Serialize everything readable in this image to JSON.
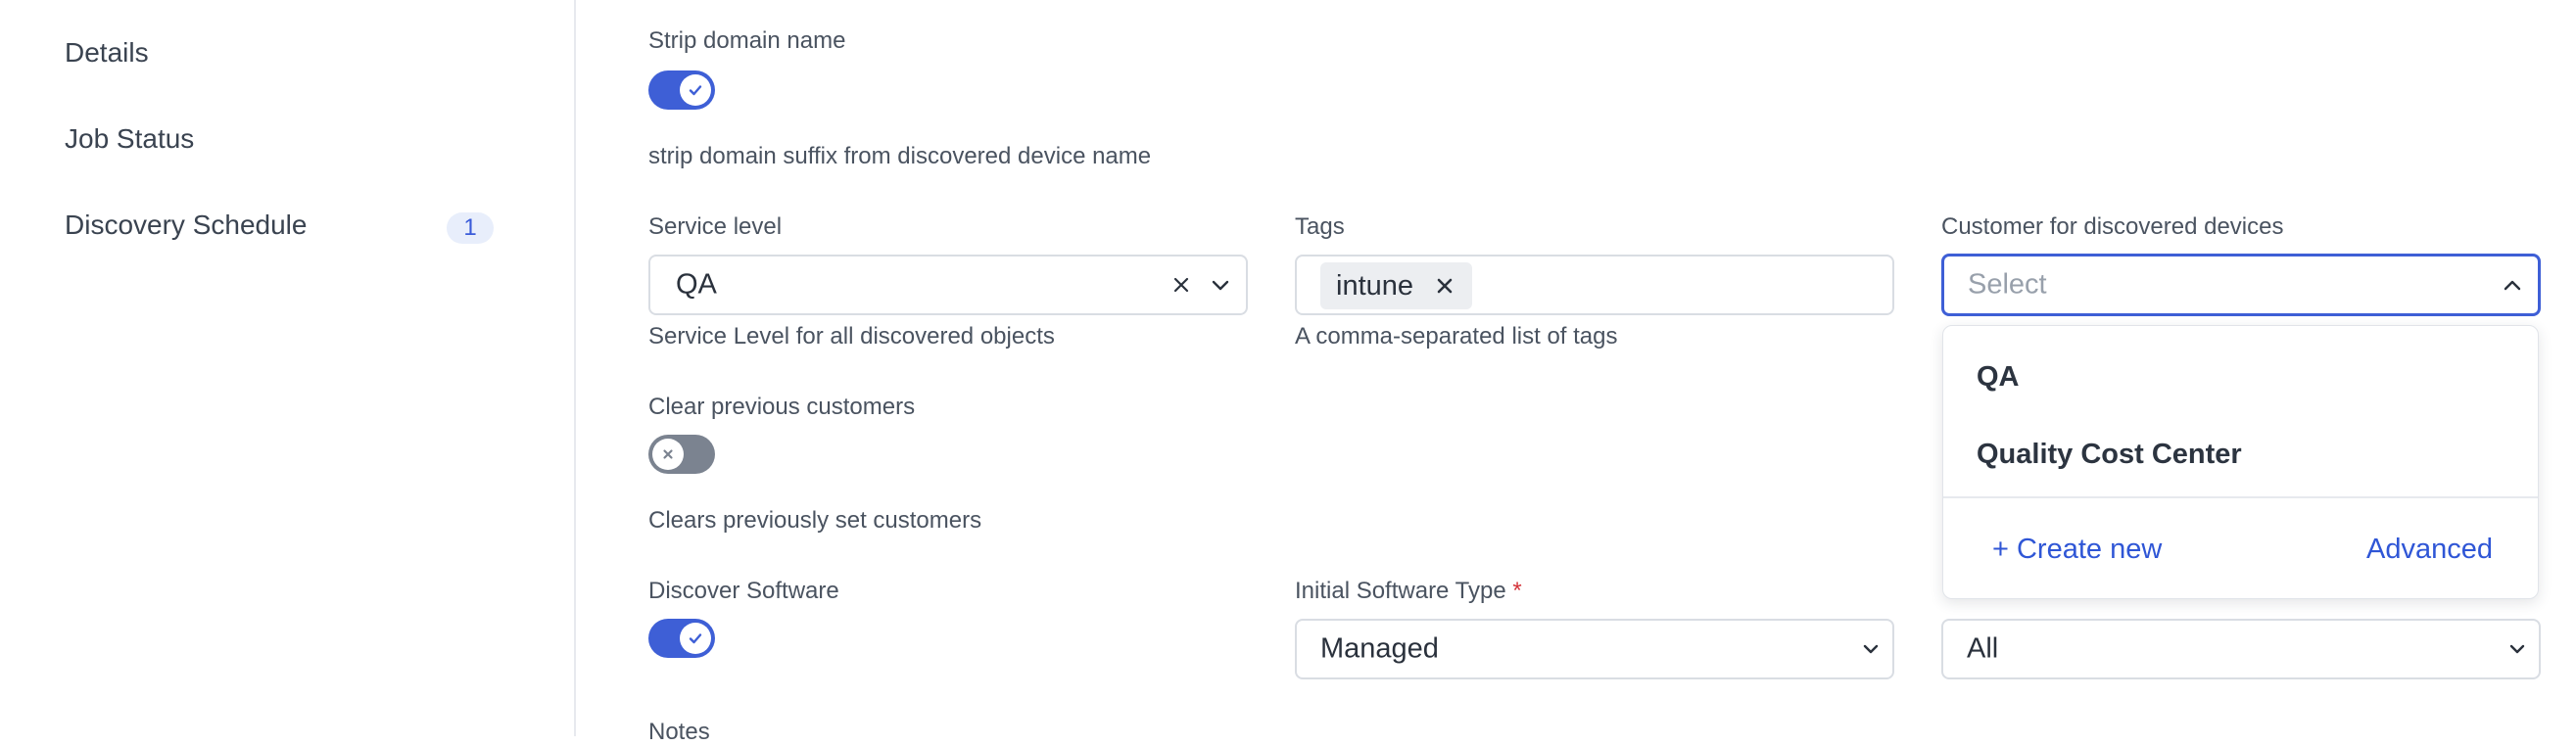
{
  "sidebar": {
    "items": [
      {
        "label": "Details"
      },
      {
        "label": "Job Status"
      },
      {
        "label": "Discovery Schedule",
        "badge": "1"
      }
    ]
  },
  "form": {
    "strip_domain": {
      "label": "Strip domain name",
      "enabled": true,
      "help": "strip domain suffix from discovered device name"
    },
    "service_level": {
      "label": "Service level",
      "value": "QA",
      "help": "Service Level for all discovered objects"
    },
    "tags": {
      "label": "Tags",
      "chips": [
        "intune"
      ],
      "help": "A comma-separated list of tags"
    },
    "customer": {
      "label": "Customer for discovered devices",
      "placeholder": "Select",
      "options": [
        "QA",
        "Quality Cost Center"
      ],
      "create_new": "+ Create new",
      "advanced": "Advanced"
    },
    "clear_customers": {
      "label": "Clear previous customers",
      "enabled": false,
      "help": "Clears previously set customers"
    },
    "discover_software": {
      "label": "Discover Software",
      "enabled": true
    },
    "initial_software_type": {
      "label": "Initial Software Type",
      "required_mark": "*",
      "value": "Managed"
    },
    "third_select": {
      "value": "All"
    },
    "notes": {
      "label": "Notes"
    }
  },
  "colors": {
    "accent": "#3e5fd6",
    "toggle_off": "#7b8390",
    "link": "#2f56d6",
    "required": "#d4343a"
  }
}
